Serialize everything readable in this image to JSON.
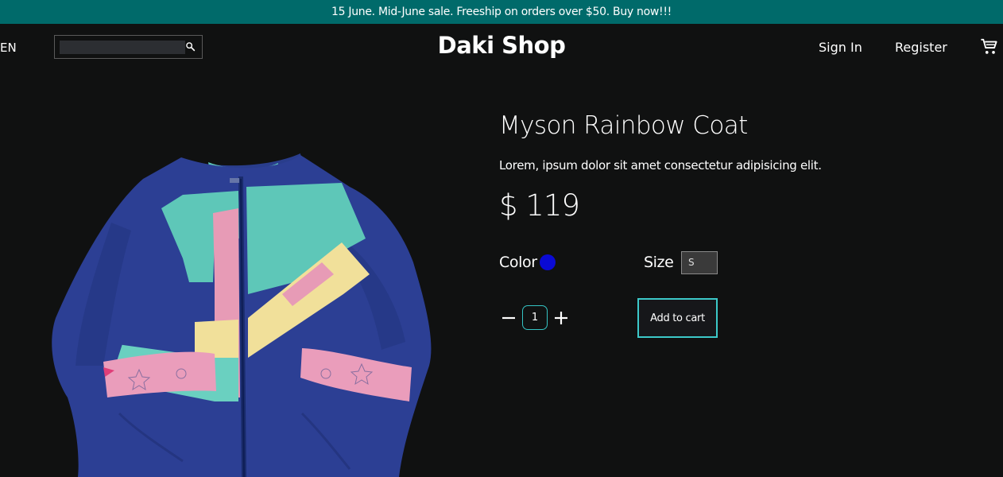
{
  "announcement": "15 June. Mid-June sale. Freeship on orders over $50. Buy now!!!",
  "header": {
    "language": "EN",
    "search_placeholder": "",
    "logo": "Daki Shop",
    "sign_in": "Sign In",
    "register": "Register",
    "cart_icon": "cart-icon"
  },
  "product": {
    "title": "Myson Rainbow Coat",
    "description": "Lorem, ipsum dolor sit amet consectetur adipisicing elit.",
    "price": "$ 119",
    "color_label": "Color",
    "color_value": "#0a0ad4",
    "size_label": "Size",
    "size_value": "S",
    "quantity": "1",
    "add_to_cart": "Add to cart"
  },
  "colors": {
    "banner": "#006a6a",
    "accent": "#3cc9c9",
    "background": "#101111"
  }
}
